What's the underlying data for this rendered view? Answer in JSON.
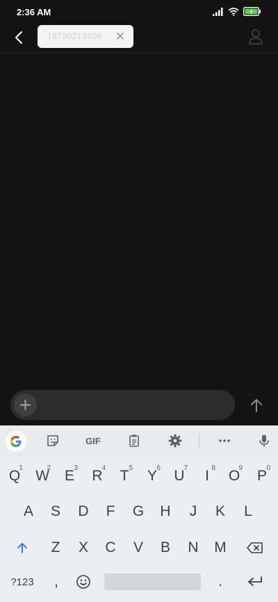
{
  "status": {
    "time": "2:36 AM",
    "icons": [
      "signal-icon",
      "wifi-icon",
      "battery-charging-icon"
    ],
    "battery_color": "#4fd34b"
  },
  "header": {
    "back_icon": "back-arrow-icon",
    "recipient_chip": "18730219806",
    "chip_close_icon": "close-icon",
    "contact_icon": "contact-icon"
  },
  "composer": {
    "plus_icon": "plus-icon",
    "send_icon": "send-arrow-icon"
  },
  "keyboard": {
    "toolbar": {
      "google": "google-icon",
      "sticker": "sticker-icon",
      "gif_label": "GIF",
      "clipboard": "clipboard-icon",
      "settings": "settings-icon",
      "more": "more-icon",
      "mic": "mic-icon"
    },
    "row1": [
      {
        "k": "Q",
        "n": "1"
      },
      {
        "k": "W",
        "n": "2"
      },
      {
        "k": "E",
        "n": "3"
      },
      {
        "k": "R",
        "n": "4"
      },
      {
        "k": "T",
        "n": "5"
      },
      {
        "k": "Y",
        "n": "6"
      },
      {
        "k": "U",
        "n": "7"
      },
      {
        "k": "I",
        "n": "8"
      },
      {
        "k": "O",
        "n": "9"
      },
      {
        "k": "P",
        "n": "0"
      }
    ],
    "row2": [
      "A",
      "S",
      "D",
      "F",
      "G",
      "H",
      "J",
      "K",
      "L"
    ],
    "row3": [
      "Z",
      "X",
      "C",
      "V",
      "B",
      "N",
      "M"
    ],
    "row4": {
      "symbols_label": "?123",
      "comma_label": ",",
      "period_label": "."
    },
    "accent_color": "#1a73e8"
  }
}
